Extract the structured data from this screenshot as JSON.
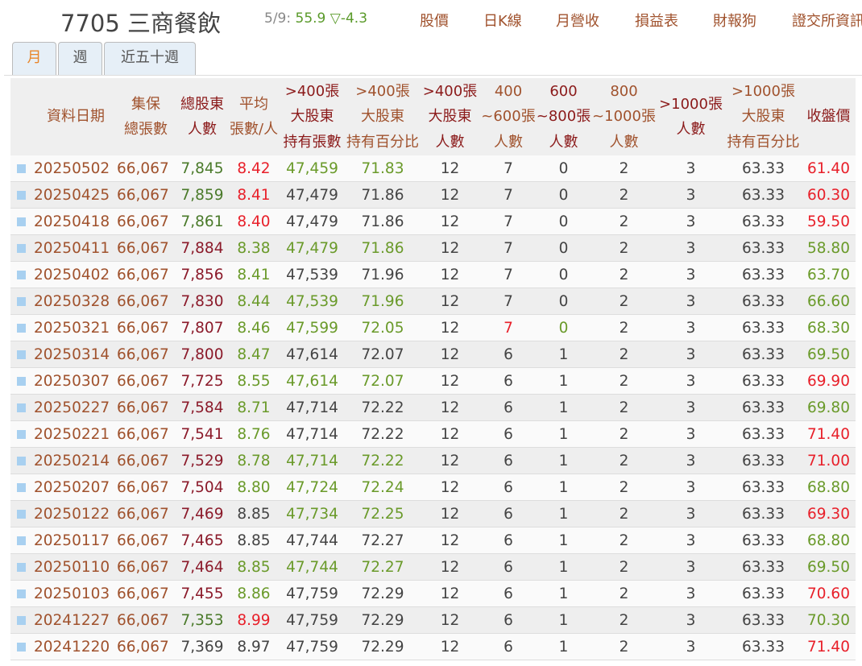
{
  "header": {
    "title": "7705 三商餐飲",
    "quote_date": "5/9:",
    "quote_price": "55.9",
    "quote_change": "▽-4.3",
    "nav": [
      "股價",
      "日K線",
      "月營收",
      "損益表",
      "財報狗",
      "證交所資訊"
    ]
  },
  "tabs": [
    "月",
    "週",
    "近五十週"
  ],
  "colors": {
    "D": "#4a7a2a",
    "R": "#8b1a2a",
    "r": "#e8202a",
    "g": "#6a9a2a",
    "k": "#444444"
  },
  "columns": [
    [
      "資料日期"
    ],
    [
      "集保",
      "總張數"
    ],
    [
      "總股東",
      "人數"
    ],
    [
      "平均",
      "張數/人"
    ],
    [
      ">400張",
      "大股東",
      "持有張數"
    ],
    [
      ">400張",
      "大股東",
      "持有百分比"
    ],
    [
      ">400張",
      "大股東",
      "人數"
    ],
    [
      "400",
      "~600張",
      "人數"
    ],
    [
      "600",
      "~800張",
      "人數"
    ],
    [
      "800",
      "~1000張",
      "人數"
    ],
    [
      ">1000張",
      "人數"
    ],
    [
      ">1000張",
      "大股東",
      "持有百分比"
    ],
    [
      "收盤價"
    ]
  ],
  "rows": [
    {
      "v": [
        "20250502",
        "66,067",
        "7,845",
        "8.42",
        "47,459",
        "71.83",
        "12",
        "7",
        "0",
        "2",
        "3",
        "63.33",
        "61.40"
      ],
      "c": "Drggkkkkkkr"
    },
    {
      "v": [
        "20250425",
        "66,067",
        "7,859",
        "8.41",
        "47,479",
        "71.86",
        "12",
        "7",
        "0",
        "2",
        "3",
        "63.33",
        "60.30"
      ],
      "c": "Drkkkkkkkkr"
    },
    {
      "v": [
        "20250418",
        "66,067",
        "7,861",
        "8.40",
        "47,479",
        "71.86",
        "12",
        "7",
        "0",
        "2",
        "3",
        "63.33",
        "59.50"
      ],
      "c": "Drkkkkkkkkr"
    },
    {
      "v": [
        "20250411",
        "66,067",
        "7,884",
        "8.38",
        "47,479",
        "71.86",
        "12",
        "7",
        "0",
        "2",
        "3",
        "63.33",
        "58.80"
      ],
      "c": "Rgggkkkkkkg"
    },
    {
      "v": [
        "20250402",
        "66,067",
        "7,856",
        "8.41",
        "47,539",
        "71.96",
        "12",
        "7",
        "0",
        "2",
        "3",
        "63.33",
        "63.70"
      ],
      "c": "Rgkkkkkkkkg"
    },
    {
      "v": [
        "20250328",
        "66,067",
        "7,830",
        "8.44",
        "47,539",
        "71.96",
        "12",
        "7",
        "0",
        "2",
        "3",
        "63.33",
        "66.60"
      ],
      "c": "Rgggkkkkkkg"
    },
    {
      "v": [
        "20250321",
        "66,067",
        "7,807",
        "8.46",
        "47,599",
        "72.05",
        "12",
        "7",
        "0",
        "2",
        "3",
        "63.33",
        "68.30"
      ],
      "c": "Rgggkrgkkkg"
    },
    {
      "v": [
        "20250314",
        "66,067",
        "7,800",
        "8.47",
        "47,614",
        "72.07",
        "12",
        "6",
        "1",
        "2",
        "3",
        "63.33",
        "69.50"
      ],
      "c": "Rgkkkkkkkkg"
    },
    {
      "v": [
        "20250307",
        "66,067",
        "7,725",
        "8.55",
        "47,614",
        "72.07",
        "12",
        "6",
        "1",
        "2",
        "3",
        "63.33",
        "69.90"
      ],
      "c": "Rgggkkkkkkr"
    },
    {
      "v": [
        "20250227",
        "66,067",
        "7,584",
        "8.71",
        "47,714",
        "72.22",
        "12",
        "6",
        "1",
        "2",
        "3",
        "63.33",
        "69.80"
      ],
      "c": "Rgkkkkkkkkg"
    },
    {
      "v": [
        "20250221",
        "66,067",
        "7,541",
        "8.76",
        "47,714",
        "72.22",
        "12",
        "6",
        "1",
        "2",
        "3",
        "63.33",
        "71.40"
      ],
      "c": "Rgkkkkkkkkr"
    },
    {
      "v": [
        "20250214",
        "66,067",
        "7,529",
        "8.78",
        "47,714",
        "72.22",
        "12",
        "6",
        "1",
        "2",
        "3",
        "63.33",
        "71.00"
      ],
      "c": "Rgggkkkkkkr"
    },
    {
      "v": [
        "20250207",
        "66,067",
        "7,504",
        "8.80",
        "47,724",
        "72.24",
        "12",
        "6",
        "1",
        "2",
        "3",
        "63.33",
        "68.80"
      ],
      "c": "Rgggkkkkkkg"
    },
    {
      "v": [
        "20250122",
        "66,067",
        "7,469",
        "8.85",
        "47,734",
        "72.25",
        "12",
        "6",
        "1",
        "2",
        "3",
        "63.33",
        "69.30"
      ],
      "c": "Rkggkkkkkkr"
    },
    {
      "v": [
        "20250117",
        "66,067",
        "7,465",
        "8.85",
        "47,744",
        "72.27",
        "12",
        "6",
        "1",
        "2",
        "3",
        "63.33",
        "68.80"
      ],
      "c": "Rkkkkkkkkkg"
    },
    {
      "v": [
        "20250110",
        "66,067",
        "7,464",
        "8.85",
        "47,744",
        "72.27",
        "12",
        "6",
        "1",
        "2",
        "3",
        "63.33",
        "69.50"
      ],
      "c": "Rgggkkkkkkg"
    },
    {
      "v": [
        "20250103",
        "66,067",
        "7,455",
        "8.86",
        "47,759",
        "72.29",
        "12",
        "6",
        "1",
        "2",
        "3",
        "63.33",
        "70.60"
      ],
      "c": "Rgkkkkkkkkr"
    },
    {
      "v": [
        "20241227",
        "66,067",
        "7,353",
        "8.99",
        "47,759",
        "72.29",
        "12",
        "6",
        "1",
        "2",
        "3",
        "63.33",
        "70.30"
      ],
      "c": "Drkkkkkkkkg"
    },
    {
      "v": [
        "20241220",
        "66,067",
        "7,369",
        "8.97",
        "47,759",
        "72.29",
        "12",
        "6",
        "1",
        "2",
        "3",
        "63.33",
        "71.40"
      ],
      "c": "kkkkkkkkkkr"
    }
  ]
}
